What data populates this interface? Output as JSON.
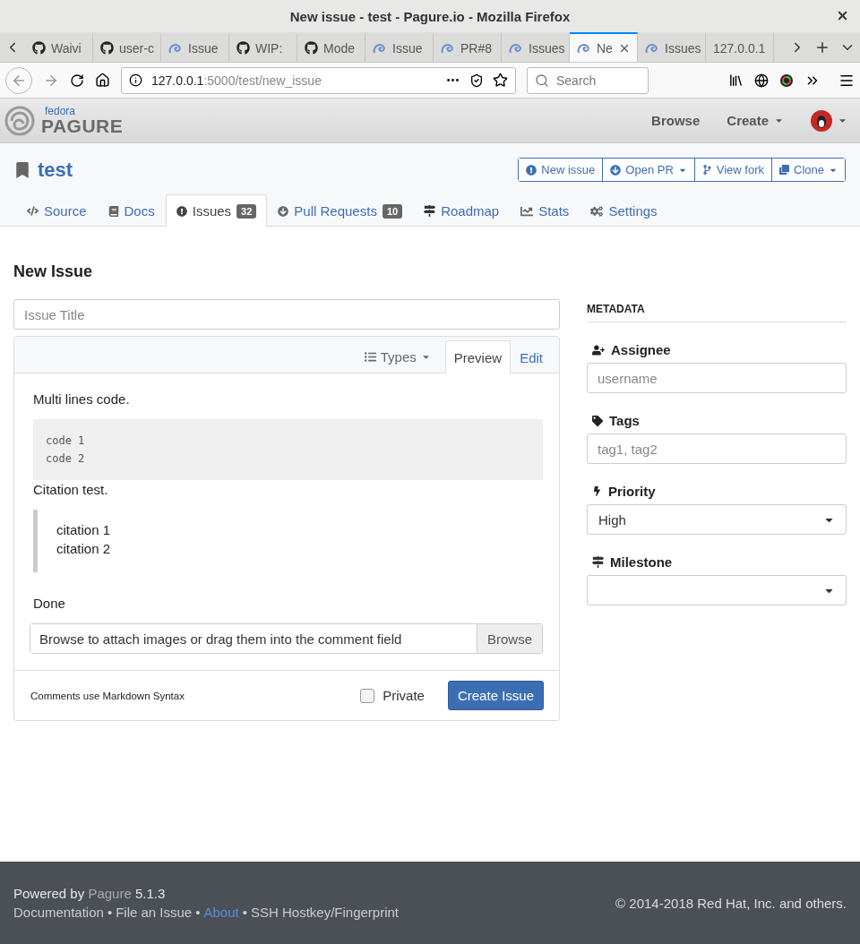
{
  "window": {
    "title": "New issue - test - Pagure.io - Mozilla Firefox"
  },
  "browser_tabs": [
    {
      "label": "Waivi",
      "kind": "github",
      "selected": false
    },
    {
      "label": "user-c",
      "kind": "github",
      "selected": false
    },
    {
      "label": "Issue",
      "kind": "pagure",
      "selected": false
    },
    {
      "label": "WIP:",
      "kind": "github",
      "selected": false
    },
    {
      "label": "Mode",
      "kind": "github",
      "selected": false
    },
    {
      "label": "Issue",
      "kind": "pagure",
      "selected": false
    },
    {
      "label": "PR#8",
      "kind": "pagure",
      "selected": false
    },
    {
      "label": "Issues",
      "kind": "pagure",
      "selected": false
    },
    {
      "label": "Ne",
      "kind": "pagure",
      "selected": true
    },
    {
      "label": "Issues",
      "kind": "pagure",
      "selected": false
    },
    {
      "label": "127.0.0.1",
      "kind": "plain",
      "selected": false
    }
  ],
  "address_bar": {
    "host": "127.0.0.1",
    "path": ":5000/test/new_issue"
  },
  "search": {
    "placeholder": "Search"
  },
  "site_header": {
    "logo_small": "fedora",
    "logo": "PAGURE",
    "nav": [
      {
        "label": "Browse",
        "dropdown": false
      },
      {
        "label": "Create",
        "dropdown": true
      }
    ]
  },
  "repo": {
    "name": "test",
    "actions": [
      {
        "label": "New issue",
        "kind": "issue",
        "dropdown": false
      },
      {
        "label": "Open PR",
        "kind": "pr",
        "dropdown": true
      },
      {
        "label": "View fork",
        "kind": "fork",
        "dropdown": false
      },
      {
        "label": "Clone",
        "kind": "clone",
        "dropdown": true
      }
    ],
    "tabs": [
      {
        "label": "Source",
        "kind": "code",
        "selected": false
      },
      {
        "label": "Docs",
        "kind": "book",
        "selected": false
      },
      {
        "label": "Issues",
        "kind": "issue",
        "badge": "32",
        "selected": true
      },
      {
        "label": "Pull Requests",
        "kind": "pr",
        "badge": "10",
        "selected": false
      },
      {
        "label": "Roadmap",
        "kind": "signs",
        "selected": false
      },
      {
        "label": "Stats",
        "kind": "chart",
        "selected": false
      },
      {
        "label": "Settings",
        "kind": "cogs",
        "selected": false
      }
    ]
  },
  "form": {
    "heading": "New Issue",
    "title_placeholder": "Issue Title",
    "types_label": "Types",
    "editor_tabs": [
      {
        "label": "Preview",
        "selected": true
      },
      {
        "label": "Edit",
        "selected": false
      }
    ],
    "preview": [
      {
        "kind": "paragraph",
        "text": "Multi lines code."
      },
      {
        "kind": "code",
        "lines": [
          "code 1",
          "code 2"
        ]
      },
      {
        "kind": "paragraph",
        "text": "Citation test."
      },
      {
        "kind": "quote",
        "lines": [
          "citation 1",
          "citation 2"
        ]
      },
      {
        "kind": "paragraph",
        "text": "Done"
      }
    ],
    "attach": {
      "placeholder": "Browse to attach images or drag them into the comment field",
      "button": "Browse"
    },
    "markdown_note": "Comments use Markdown Syntax",
    "private": {
      "label": "Private",
      "checked": false
    },
    "submit": "Create Issue"
  },
  "metadata": {
    "heading": "METADATA",
    "fields": [
      {
        "label": "Assignee",
        "kind": "assignee",
        "placeholder": "username"
      },
      {
        "label": "Tags",
        "kind": "tags",
        "placeholder": "tag1, tag2"
      },
      {
        "label": "Priority",
        "kind": "priority",
        "value": "High"
      },
      {
        "label": "Milestone",
        "kind": "milestone"
      }
    ]
  },
  "footer": {
    "powered": "Powered by",
    "product": "Pagure",
    "version": "5.1.3",
    "links": [
      {
        "label": "Documentation",
        "highlighted": false
      },
      {
        "label": "File an Issue",
        "highlighted": false
      },
      {
        "label": "About",
        "highlighted": true
      },
      {
        "label": "SSH Hostkey/Fingerprint",
        "highlighted": false
      }
    ],
    "separator": "•",
    "copyright": "© 2014-2018 Red Hat, Inc. and others."
  }
}
